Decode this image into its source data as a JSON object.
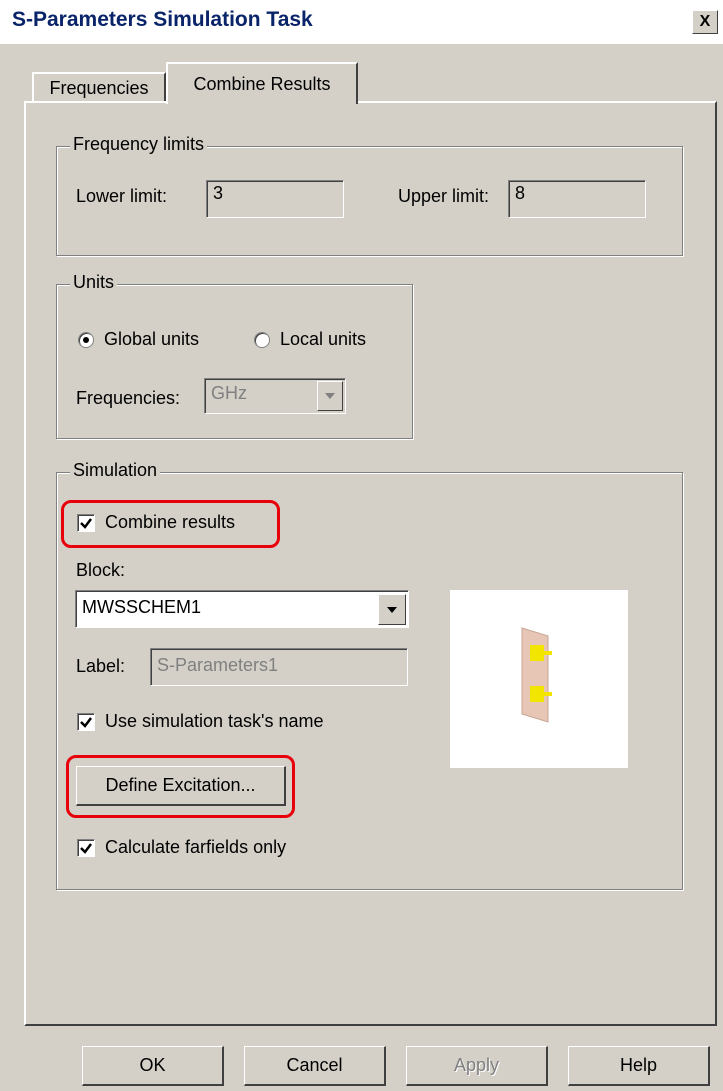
{
  "window": {
    "title": "S-Parameters Simulation Task",
    "close_label": "X"
  },
  "tabs": [
    {
      "label": "Frequencies",
      "active": false
    },
    {
      "label": "Combine Results",
      "active": true
    }
  ],
  "frequency_limits": {
    "legend": "Frequency limits",
    "lower_label": "Lower limit:",
    "lower_value": "3",
    "upper_label": "Upper limit:",
    "upper_value": "8"
  },
  "units": {
    "legend": "Units",
    "global_label": "Global units",
    "local_label": "Local units",
    "selected": "global",
    "frequencies_label": "Frequencies:",
    "frequencies_value": "GHz"
  },
  "simulation": {
    "legend": "Simulation",
    "combine_results_label": "Combine results",
    "combine_results_checked": true,
    "block_label": "Block:",
    "block_value": "MWSSCHEM1",
    "label_label": "Label:",
    "label_value": "S-Parameters1",
    "use_task_name_label": "Use simulation task's name",
    "use_task_name_checked": true,
    "define_excitation_label": "Define Excitation...",
    "calc_farfields_label": "Calculate farfields only",
    "calc_farfields_checked": true
  },
  "buttons": {
    "ok": "OK",
    "cancel": "Cancel",
    "apply": "Apply",
    "help": "Help"
  },
  "colors": {
    "highlight": "#e8000b",
    "title_text": "#0a246a",
    "dialog_bg": "#d4d0c8"
  }
}
